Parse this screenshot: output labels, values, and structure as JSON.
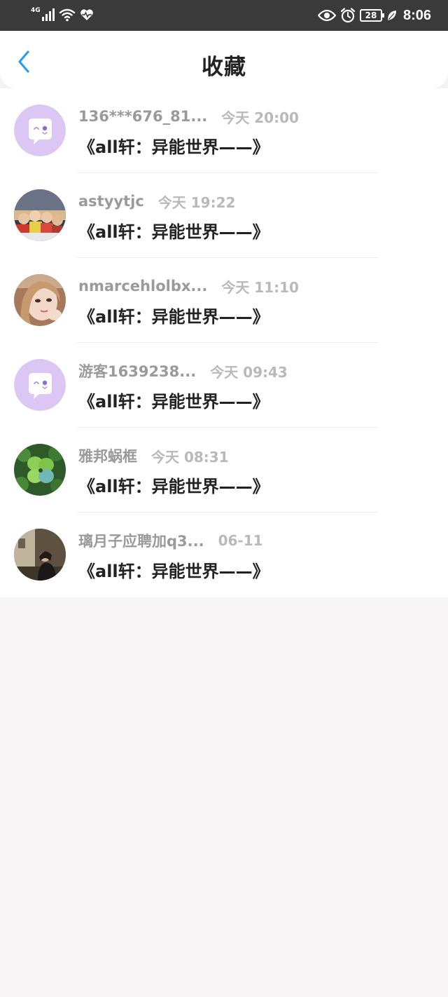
{
  "status_bar": {
    "network": "4G",
    "battery": "28",
    "time": "8:06",
    "icons": [
      "signal-icon",
      "wifi-icon",
      "heart-monitor-icon",
      "eye-icon",
      "alarm-icon",
      "battery-icon",
      "leaf-icon"
    ]
  },
  "header": {
    "title": "收藏",
    "back_icon": "chevron-left-icon"
  },
  "colors": {
    "accent": "#2b9cf2",
    "status_bar_bg": "#3a3a3a",
    "page_bg": "#f7f5f6",
    "username": "#9a9a9a",
    "timestamp": "#b9b9b9",
    "title_text": "#222222",
    "default_avatar_bg": "#dcc6f3"
  },
  "items": [
    {
      "username": "136***676_81...",
      "time": "今天 20:00",
      "title": "《all轩：异能世界——》",
      "avatar": "default-avatar-icon"
    },
    {
      "username": "astyytjc",
      "time": "今天 19:22",
      "title": "《all轩：异能世界——》",
      "avatar": "group-photo-avatar"
    },
    {
      "username": "nmarcehlolbx...",
      "time": "今天 11:10",
      "title": "《all轩：异能世界——》",
      "avatar": "girl-photo-avatar"
    },
    {
      "username": "游客1639238...",
      "time": "今天 09:43",
      "title": "《all轩：异能世界——》",
      "avatar": "default-avatar-icon"
    },
    {
      "username": "雅邦蜗框",
      "time": "今天 08:31",
      "title": "《all轩：异能世界——》",
      "avatar": "clover-photo-avatar"
    },
    {
      "username": "璃月子应聘加q3...",
      "time": "06-11",
      "title": "《all轩：异能世界——》",
      "avatar": "room-photo-avatar"
    }
  ]
}
